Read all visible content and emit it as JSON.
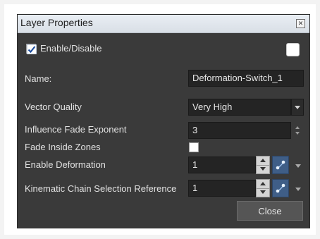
{
  "window": {
    "title": "Layer Properties"
  },
  "enable": {
    "label": "Enable/Disable",
    "checked": true,
    "color_swatch": "#ffffff"
  },
  "name": {
    "label": "Name:",
    "value": "Deformation-Switch_1"
  },
  "vector_quality": {
    "label": "Vector Quality",
    "value": "Very High"
  },
  "influence_fade": {
    "label": "Influence Fade Exponent",
    "value": "3"
  },
  "fade_inside": {
    "label": "Fade Inside Zones",
    "checked": false
  },
  "enable_deformation": {
    "label": "Enable Deformation",
    "value": "1"
  },
  "kinematic": {
    "label": "Kinematic Chain Selection Reference",
    "value": "1"
  },
  "buttons": {
    "close": "Close"
  },
  "colors": {
    "dialog_bg": "#3a3a3a",
    "field_bg": "#242424",
    "link_button": "#3f5e87",
    "titlebar": "#e9eef4"
  }
}
